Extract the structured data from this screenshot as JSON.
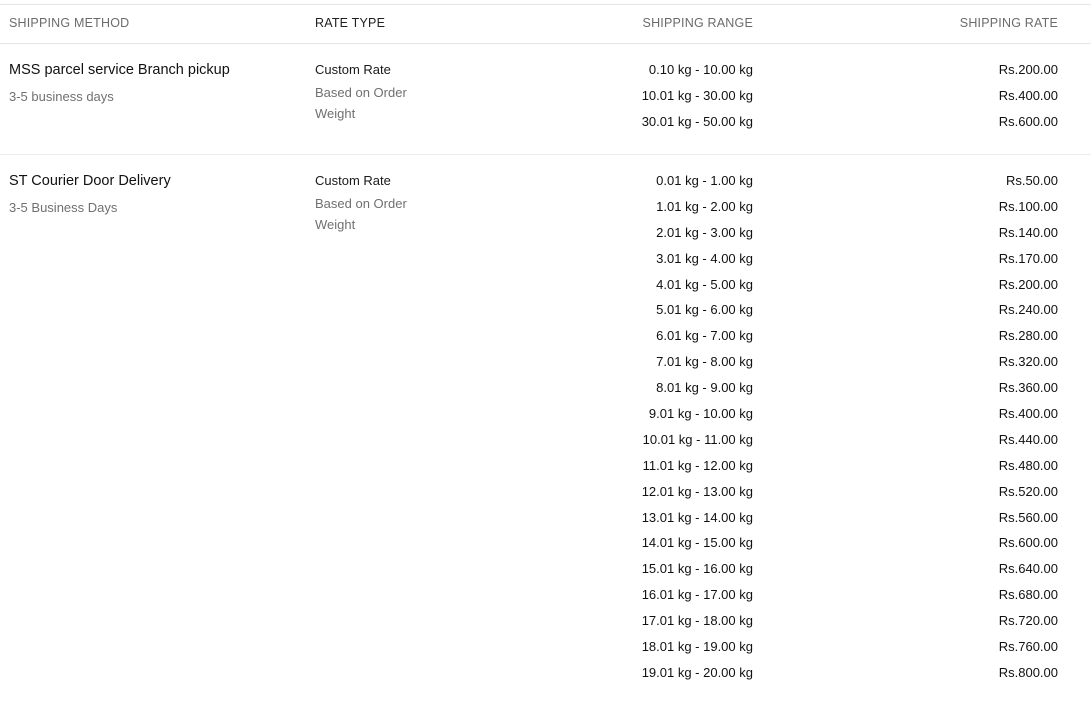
{
  "headers": {
    "method": "SHIPPING METHOD",
    "rate_type": "RATE TYPE",
    "range": "SHIPPING RANGE",
    "rate": "SHIPPING RATE"
  },
  "methods": [
    {
      "name": "MSS parcel service Branch pickup",
      "days": "3-5 business days",
      "rate_type": "Custom Rate",
      "rate_basis": "Based on Order Weight",
      "rows": [
        {
          "range": "0.10 kg - 10.00 kg",
          "rate": "Rs.200.00"
        },
        {
          "range": "10.01 kg - 30.00 kg",
          "rate": "Rs.400.00"
        },
        {
          "range": "30.01 kg - 50.00 kg",
          "rate": "Rs.600.00"
        }
      ]
    },
    {
      "name": "ST Courier Door Delivery",
      "days": "3-5 Business Days",
      "rate_type": "Custom Rate",
      "rate_basis": "Based on Order Weight",
      "rows": [
        {
          "range": "0.01 kg - 1.00 kg",
          "rate": "Rs.50.00"
        },
        {
          "range": "1.01 kg - 2.00 kg",
          "rate": "Rs.100.00"
        },
        {
          "range": "2.01 kg - 3.00 kg",
          "rate": "Rs.140.00"
        },
        {
          "range": "3.01 kg - 4.00 kg",
          "rate": "Rs.170.00"
        },
        {
          "range": "4.01 kg - 5.00 kg",
          "rate": "Rs.200.00"
        },
        {
          "range": "5.01 kg - 6.00 kg",
          "rate": "Rs.240.00"
        },
        {
          "range": "6.01 kg - 7.00 kg",
          "rate": "Rs.280.00"
        },
        {
          "range": "7.01 kg - 8.00 kg",
          "rate": "Rs.320.00"
        },
        {
          "range": "8.01 kg - 9.00 kg",
          "rate": "Rs.360.00"
        },
        {
          "range": "9.01 kg - 10.00 kg",
          "rate": "Rs.400.00"
        },
        {
          "range": "10.01 kg - 11.00 kg",
          "rate": "Rs.440.00"
        },
        {
          "range": "11.01 kg - 12.00 kg",
          "rate": "Rs.480.00"
        },
        {
          "range": "12.01 kg - 13.00 kg",
          "rate": "Rs.520.00"
        },
        {
          "range": "13.01 kg - 14.00 kg",
          "rate": "Rs.560.00"
        },
        {
          "range": "14.01 kg - 15.00 kg",
          "rate": "Rs.600.00"
        },
        {
          "range": "15.01 kg - 16.00 kg",
          "rate": "Rs.640.00"
        },
        {
          "range": "16.01 kg - 17.00 kg",
          "rate": "Rs.680.00"
        },
        {
          "range": "17.01 kg - 18.00 kg",
          "rate": "Rs.720.00"
        },
        {
          "range": "18.01 kg - 19.00 kg",
          "rate": "Rs.760.00"
        },
        {
          "range": "19.01 kg - 20.00 kg",
          "rate": "Rs.800.00"
        }
      ]
    }
  ]
}
